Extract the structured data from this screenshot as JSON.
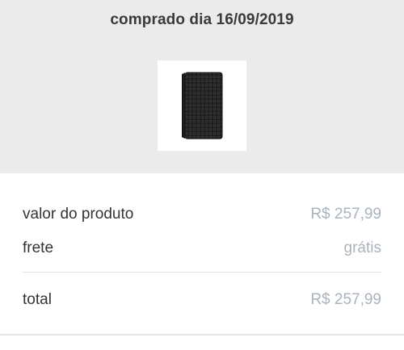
{
  "header": {
    "title": "comprado dia 16/09/2019",
    "product_image": "external-hard-drive-image"
  },
  "summary": {
    "rows": [
      {
        "label": "valor do produto",
        "value": "R$ 257,99"
      },
      {
        "label": "frete",
        "value": "grátis"
      }
    ],
    "total": {
      "label": "total",
      "value": "R$ 257,99"
    }
  },
  "colors": {
    "header_bg": "#ebebeb",
    "label_text": "#333333",
    "value_text": "#aab3bd"
  }
}
